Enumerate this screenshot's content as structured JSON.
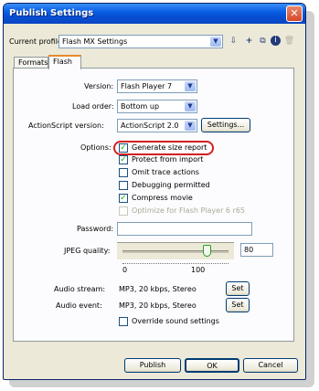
{
  "window": {
    "title": "Publish Settings",
    "close_label": "✕"
  },
  "profile": {
    "label": "Current profile:",
    "value": "Flash MX Settings"
  },
  "tabs": [
    {
      "label": "Formats"
    },
    {
      "label": "Flash"
    }
  ],
  "version": {
    "label": "Version:",
    "value": "Flash Player 7"
  },
  "load_order": {
    "label": "Load order:",
    "value": "Bottom up"
  },
  "actionscript": {
    "label": "ActionScript version:",
    "value": "ActionScript 2.0",
    "settings_label": "Settings..."
  },
  "options": {
    "label": "Options:",
    "items": [
      {
        "label": "Generate size report",
        "checked": true
      },
      {
        "label": "Protect from import",
        "checked": true
      },
      {
        "label": "Omit trace actions",
        "checked": false
      },
      {
        "label": "Debugging permitted",
        "checked": false
      },
      {
        "label": "Compress movie",
        "checked": true
      },
      {
        "label": "Optimize for Flash Player 6 r65",
        "checked": false,
        "disabled": true
      }
    ]
  },
  "password": {
    "label": "Password:",
    "value": ""
  },
  "jpeg": {
    "label": "JPEG quality:",
    "value": "80",
    "min_label": "0",
    "max_label": "100",
    "slider_value": 80
  },
  "audio_stream": {
    "label": "Audio stream:",
    "value": "MP3, 20 kbps, Stereo",
    "button": "Set"
  },
  "audio_event": {
    "label": "Audio event:",
    "value": "MP3, 20 kbps, Stereo",
    "button": "Set"
  },
  "override": {
    "label": "Override sound settings",
    "checked": false
  },
  "footer": {
    "publish": "Publish",
    "ok": "OK",
    "cancel": "Cancel"
  },
  "colors": {
    "title_bar": "#0a5fe3",
    "dialog_bg": "#ece9d8",
    "highlight_ring": "#d22020",
    "active_tab_accent": "#e68b2c"
  },
  "icons": [
    "chevron-down-icon",
    "import-profile-icon",
    "add-profile-icon",
    "duplicate-profile-icon",
    "info-icon",
    "delete-profile-icon",
    "checkmark-icon",
    "close-icon"
  ]
}
